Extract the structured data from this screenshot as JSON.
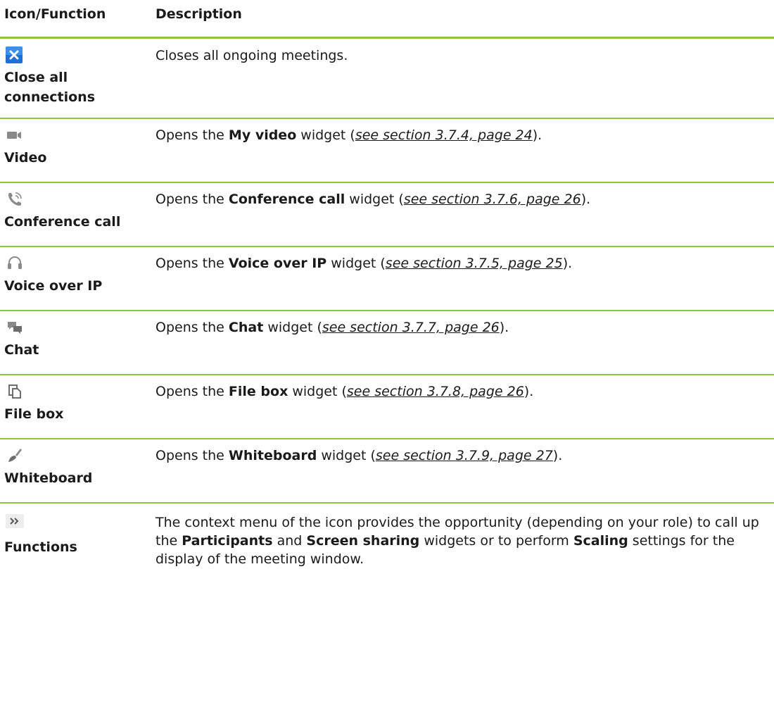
{
  "table": {
    "headers": {
      "icon_function": "Icon/Function",
      "description": "Description"
    },
    "rows": [
      {
        "icon": "close-x-icon",
        "label": "Close all connections",
        "text": "Closes all ongoing meetings."
      },
      {
        "icon": "video-camera-icon",
        "label": "Video",
        "pre": "Opens the ",
        "bold": "My video",
        "mid": " widget (",
        "ref": "see section 3.7.4, page 24",
        "post": ")."
      },
      {
        "icon": "phone-icon",
        "label": "Conference call",
        "pre": "Opens the ",
        "bold": "Conference call",
        "mid": " widget (",
        "ref": "see section 3.7.6, page 26",
        "post": ")."
      },
      {
        "icon": "headset-icon",
        "label": "Voice over IP",
        "pre": "Opens the ",
        "bold": "Voice over IP",
        "mid": " widget (",
        "ref": "see section 3.7.5, page 25",
        "post": ")."
      },
      {
        "icon": "chat-bubbles-icon",
        "label": "Chat",
        "pre": "Opens the ",
        "bold": "Chat",
        "mid": " widget (",
        "ref": "see section 3.7.7, page 26",
        "post": ")."
      },
      {
        "icon": "file-box-icon",
        "label": "File box",
        "pre": "Opens the ",
        "bold": "File box",
        "mid": " widget (",
        "ref": "see section 3.7.8, page 26",
        "post": ")."
      },
      {
        "icon": "brush-icon",
        "label": "Whiteboard",
        "pre": "Opens the ",
        "bold": "Whiteboard",
        "mid": " widget (",
        "ref": "see section 3.7.9, page 27",
        "post": ")."
      },
      {
        "icon": "double-chevron-right-icon",
        "label": "Functions",
        "t1": "The context menu of the icon provides the opportunity (depending on your role) to call up the ",
        "b1": "Participants",
        "t2": " and ",
        "b2": "Screen sharing",
        "t3": " widgets or to perform ",
        "b3": "Scaling",
        "t4": " settings for the display of the meeting window."
      }
    ]
  },
  "colors": {
    "rule": "#8cc63f",
    "close_icon_bg": "#1e6fd9",
    "icon_gray": "#8a8a8a"
  }
}
